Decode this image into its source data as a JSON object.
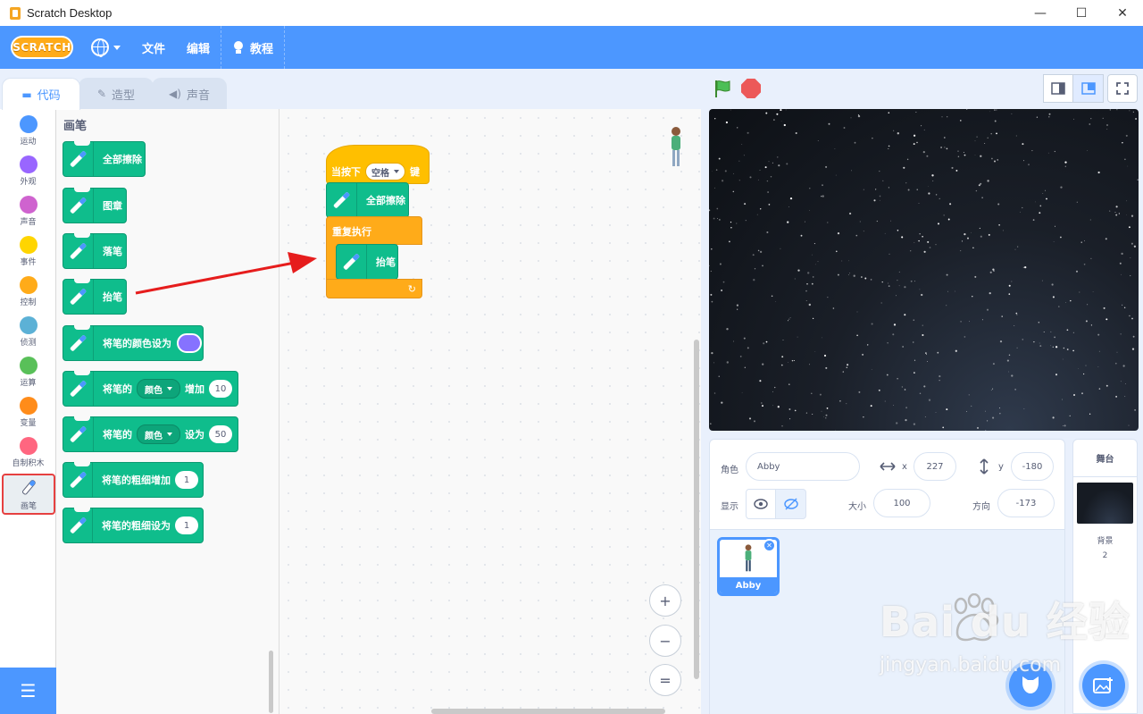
{
  "window": {
    "title": "Scratch Desktop",
    "controls": [
      "—",
      "☐",
      "✕"
    ]
  },
  "menubar": {
    "logo": "SCRATCH",
    "file": "文件",
    "edit": "编辑",
    "tutorials": "教程"
  },
  "tabs": [
    {
      "label": "代码",
      "icon": "code-icon"
    },
    {
      "label": "造型",
      "icon": "brush-icon"
    },
    {
      "label": "声音",
      "icon": "speaker-icon"
    }
  ],
  "categories": [
    {
      "label": "运动",
      "color": "#4c97ff"
    },
    {
      "label": "外观",
      "color": "#9966ff"
    },
    {
      "label": "声音",
      "color": "#cf63cf"
    },
    {
      "label": "事件",
      "color": "#ffd500"
    },
    {
      "label": "控制",
      "color": "#ffab19"
    },
    {
      "label": "侦测",
      "color": "#5cb1d6"
    },
    {
      "label": "运算",
      "color": "#59c059"
    },
    {
      "label": "变量",
      "color": "#ff8c1a"
    },
    {
      "label": "自制积木",
      "color": "#ff6680"
    },
    {
      "label": "画笔",
      "color": "#0fbd8c"
    }
  ],
  "palette": {
    "title": "画笔",
    "clear": "全部擦除",
    "stamp": "图章",
    "pen_down": "落笔",
    "pen_up": "抬笔",
    "set_color": "将笔的颜色设为",
    "change_prefix": "将笔的",
    "change_dd": "颜色",
    "change_mid": "增加",
    "change_val": "10",
    "set_prefix": "将笔的",
    "set_dd": "颜色",
    "set_mid": "设为",
    "set_val": "50",
    "size_change": "将笔的粗细增加",
    "size_change_val": "1",
    "size_set": "将笔的粗细设为",
    "size_set_val": "1",
    "swatch_color": "#8672ff"
  },
  "script": {
    "hat_prefix": "当按下",
    "hat_key": "空格",
    "hat_suffix": "键",
    "clear": "全部擦除",
    "forever": "重复执行",
    "pen_up": "抬笔"
  },
  "zoom": {
    "in": "+",
    "out": "−",
    "reset": "="
  },
  "sprite_info": {
    "sprite_label": "角色",
    "sprite_name": "Abby",
    "x_label": "x",
    "x": "227",
    "y_label": "y",
    "y": "-180",
    "show_label": "显示",
    "size_label": "大小",
    "size": "100",
    "direction_label": "方向",
    "direction": "-173"
  },
  "sprites": [
    {
      "name": "Abby"
    }
  ],
  "stage_pane": {
    "title": "舞台",
    "backdrops_label": "背景",
    "backdrops_count": "2"
  },
  "watermark": {
    "main": "Bai du 经验",
    "sub": "jingyan.baidu.com"
  }
}
